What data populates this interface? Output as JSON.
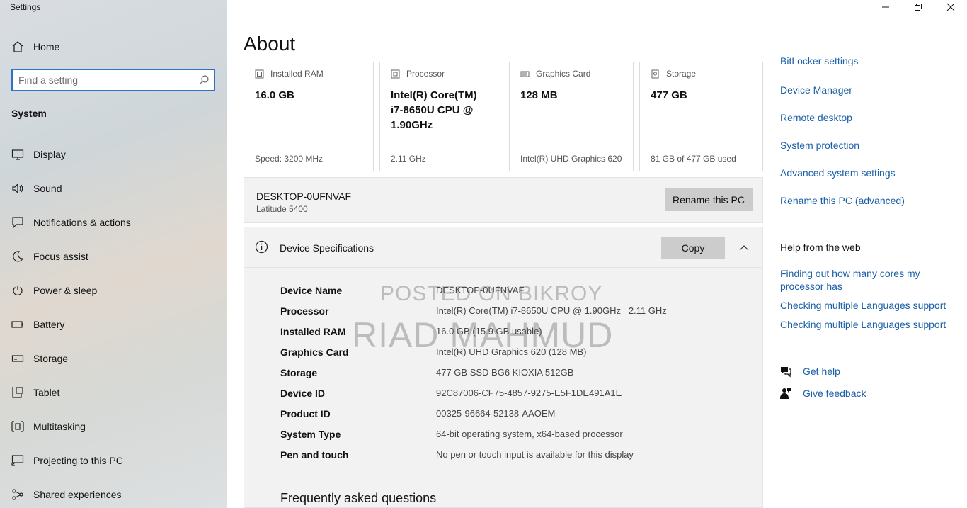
{
  "window": {
    "title": "Settings",
    "controls": {
      "minimize": "minimize",
      "maximize": "restore",
      "close": "close"
    }
  },
  "sidebar": {
    "home_label": "Home",
    "search_placeholder": "Find a setting",
    "section_heading": "System",
    "items": [
      {
        "label": "Display",
        "icon": "display-icon"
      },
      {
        "label": "Sound",
        "icon": "sound-icon"
      },
      {
        "label": "Notifications & actions",
        "icon": "notifications-icon"
      },
      {
        "label": "Focus assist",
        "icon": "focus-assist-icon"
      },
      {
        "label": "Power & sleep",
        "icon": "power-icon"
      },
      {
        "label": "Battery",
        "icon": "battery-icon"
      },
      {
        "label": "Storage",
        "icon": "storage-icon"
      },
      {
        "label": "Tablet",
        "icon": "tablet-icon"
      },
      {
        "label": "Multitasking",
        "icon": "multitasking-icon"
      },
      {
        "label": "Projecting to this PC",
        "icon": "projecting-icon"
      },
      {
        "label": "Shared experiences",
        "icon": "shared-experiences-icon"
      }
    ]
  },
  "main": {
    "title": "About",
    "cards": [
      {
        "label": "Installed RAM",
        "value": "16.0 GB",
        "sub": "Speed: 3200 MHz",
        "icon": "ram-icon"
      },
      {
        "label": "Processor",
        "value": "Intel(R) Core(TM) i7-8650U CPU @ 1.90GHz",
        "sub": "2.11 GHz",
        "icon": "processor-icon"
      },
      {
        "label": "Graphics Card",
        "value": "128 MB",
        "sub": "Intel(R) UHD Graphics 620",
        "icon": "graphics-card-icon"
      },
      {
        "label": "Storage",
        "value": "477 GB",
        "sub": "81 GB of 477 GB used",
        "icon": "storage-drive-icon"
      }
    ],
    "pc": {
      "name": "DESKTOP-0UFNVAF",
      "model": "Latitude 5400",
      "rename_label": "Rename this PC"
    },
    "specs": {
      "title": "Device Specifications",
      "copy_label": "Copy",
      "rows": [
        {
          "key": "Device Name",
          "value": "DESKTOP-0UFNVAF"
        },
        {
          "key": "Processor",
          "value": "Intel(R) Core(TM) i7-8650U CPU @ 1.90GHz   2.11 GHz"
        },
        {
          "key": "Installed RAM",
          "value": "16.0 GB (15.9 GB usable)"
        },
        {
          "key": "Graphics Card",
          "value": "Intel(R) UHD Graphics 620 (128 MB)"
        },
        {
          "key": "Storage",
          "value": "477 GB SSD BG6 KIOXIA 512GB"
        },
        {
          "key": "Device ID",
          "value": "92C87006-CF75-4857-9275-E5F1DE491A1E"
        },
        {
          "key": "Product ID",
          "value": "00325-96664-52138-AAOEM"
        },
        {
          "key": "System Type",
          "value": "64-bit operating system, x64-based processor"
        },
        {
          "key": "Pen and touch",
          "value": "No pen or touch input is available for this display"
        }
      ]
    },
    "faq_title": "Frequently asked questions",
    "watermark": {
      "line1": "POSTED ON BIKROY",
      "line2": "RIAD MAHMUD"
    }
  },
  "related": {
    "links": [
      "BitLocker settings",
      "Device Manager",
      "Remote desktop",
      "System protection",
      "Advanced system settings",
      "Rename this PC (advanced)"
    ],
    "help_heading": "Help from the web",
    "help_links": [
      "Finding out how many cores my processor has",
      "Checking multiple Languages support",
      "Checking multiple Languages support"
    ],
    "get_help": "Get help",
    "give_feedback": "Give feedback"
  },
  "colors": {
    "link": "#1a5fa8",
    "focus_border": "#2a73c6",
    "panel": "#f2f2f2",
    "button": "#cccccc"
  }
}
